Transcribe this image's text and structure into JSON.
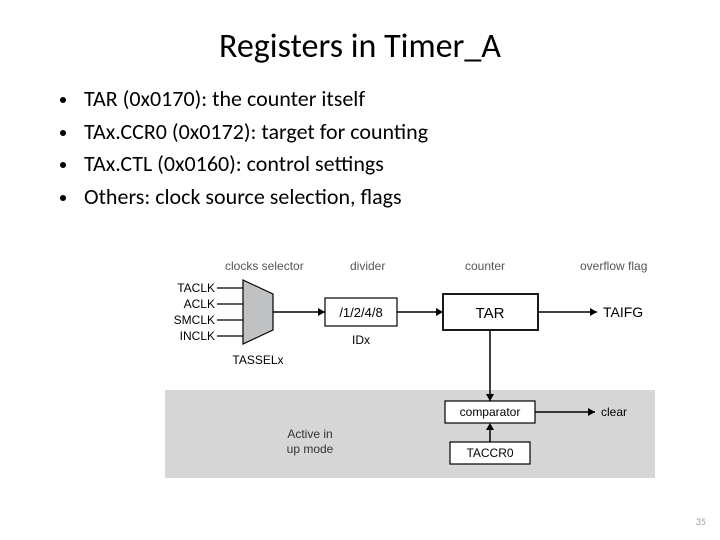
{
  "title": "Registers in Timer_A",
  "bullets": [
    "TAR (0x0170): the counter itself",
    "TAx.CCR0 (0x0172): target for counting",
    "TAx.CTL (0x0160): control settings",
    "Others: clock source selection, flags"
  ],
  "diagram": {
    "header_clocks": "clocks selector",
    "header_divider": "divider",
    "header_counter": "counter",
    "header_overflow": "overflow flag",
    "clk_taclk": "TACLK",
    "clk_aclk": "ACLK",
    "clk_smclk": "SMCLK",
    "clk_inclk": "INCLK",
    "divider_box": "/1/2/4/8",
    "counter_box": "TAR",
    "overflow_out": "TAIFG",
    "tasselx": "TASSELx",
    "idx": "IDx",
    "comparator_box": "comparator",
    "taccr0_box": "TACCR0",
    "clear_lbl": "clear",
    "active_lbl1": "Active in",
    "active_lbl2": "up mode"
  },
  "page_number": "35"
}
